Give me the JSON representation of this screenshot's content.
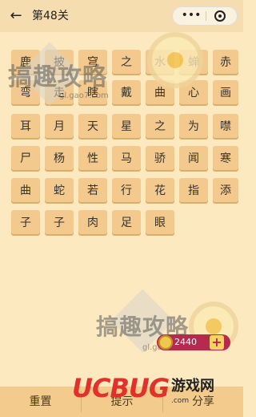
{
  "header": {
    "back_icon": "back-arrow-icon",
    "title": "第48关",
    "capsule_more": "•••",
    "capsule_close_icon": "close-circle-icon"
  },
  "grid": {
    "rows": [
      [
        "鹿",
        "披",
        "穹",
        "之",
        "水",
        "蝉",
        "赤"
      ],
      [
        "弯",
        "走",
        "瞎",
        "戴",
        "曲",
        "心",
        "画"
      ],
      [
        "耳",
        "月",
        "天",
        "星",
        "之",
        "为",
        "噤"
      ],
      [
        "尸",
        "杨",
        "性",
        "马",
        "骄",
        "闻",
        "寒"
      ],
      [
        "曲",
        "蛇",
        "若",
        "行",
        "花",
        "指",
        "添"
      ],
      [
        "子",
        "子",
        "肉",
        "足",
        "眼"
      ]
    ]
  },
  "watermark": {
    "title": "搞趣攻略",
    "url": "gl.gao7.com"
  },
  "coins": {
    "value": "2440",
    "plus": "+"
  },
  "bottom": {
    "reset_label": "重置",
    "hint_label": "提示",
    "share_label": "分享"
  },
  "brand": {
    "logo_latin": "UCBUG",
    "logo_cn": "游戏网",
    "logo_url": ".com",
    "color": "#e0312a"
  },
  "colors": {
    "background": "#fde9c0",
    "tile": "#f3c98d",
    "coin_box": "#b62a50"
  }
}
